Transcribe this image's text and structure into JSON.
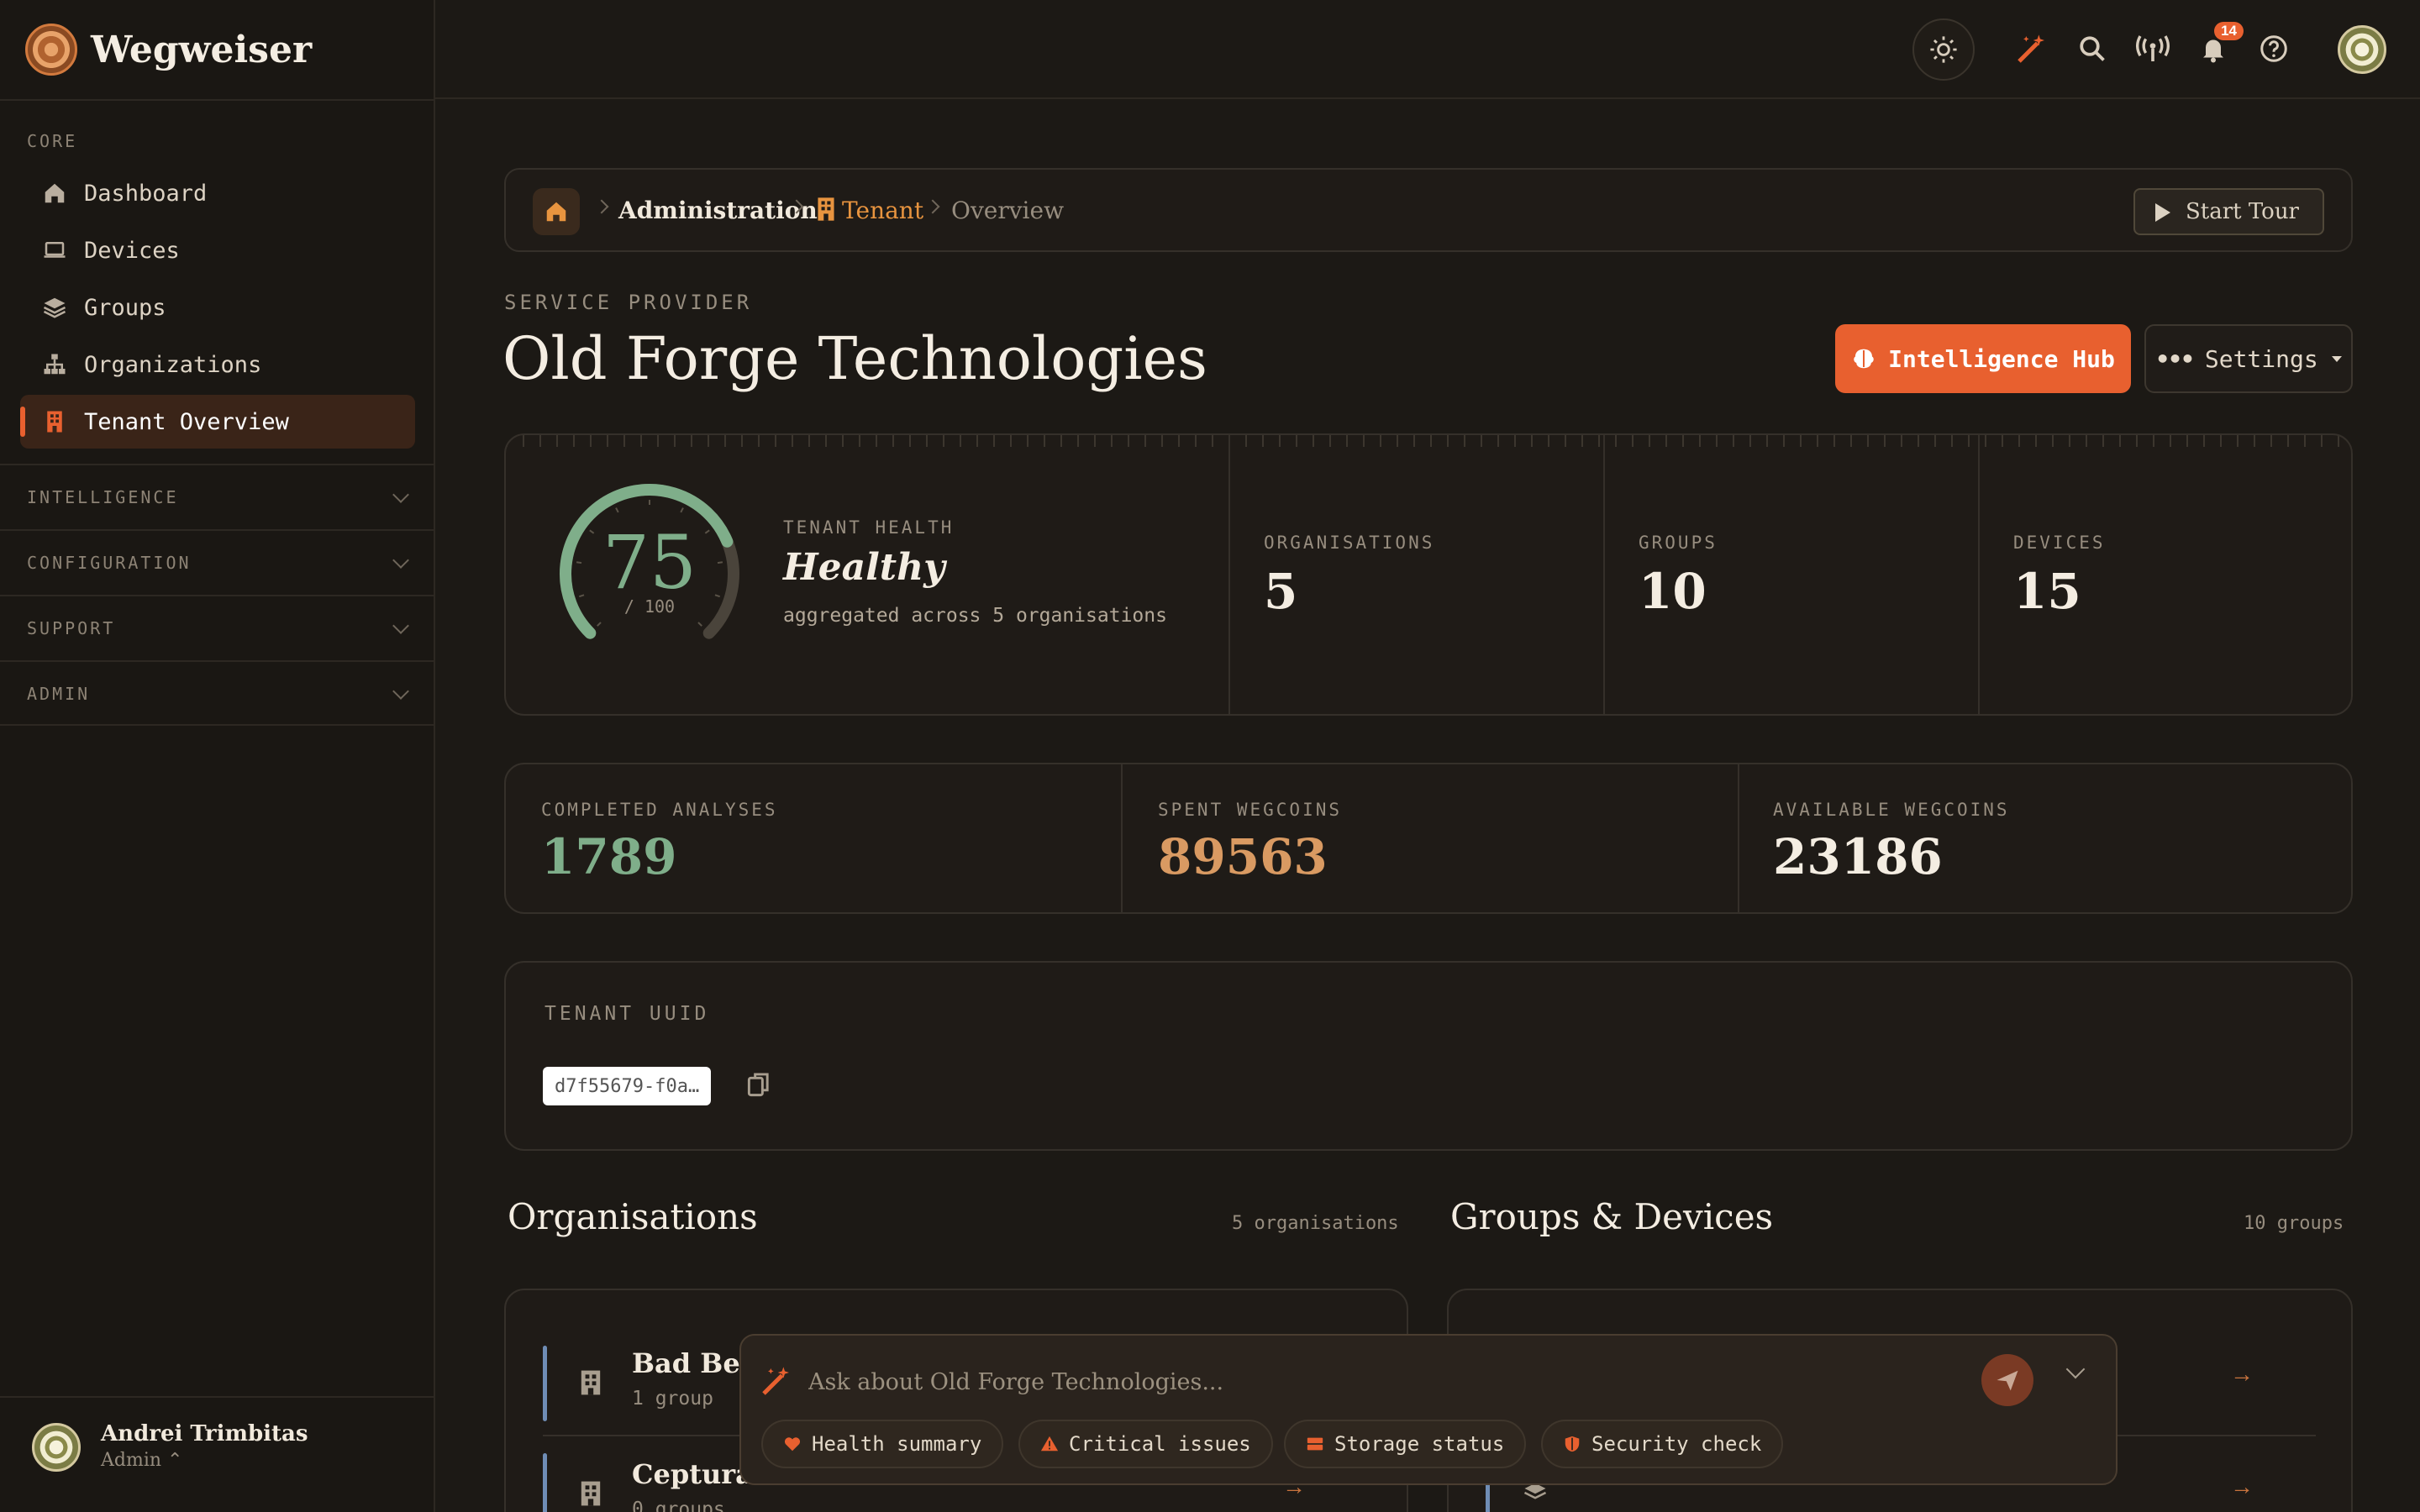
{
  "brand": {
    "name": "Wegweiser"
  },
  "sidebar": {
    "core_label": "CORE",
    "items": [
      {
        "label": "Dashboard",
        "icon": "home-icon"
      },
      {
        "label": "Devices",
        "icon": "laptop-icon"
      },
      {
        "label": "Groups",
        "icon": "layers-icon"
      },
      {
        "label": "Organizations",
        "icon": "org-chart-icon"
      },
      {
        "label": "Tenant Overview",
        "icon": "building-icon",
        "active": true
      }
    ],
    "sections": [
      "INTELLIGENCE",
      "CONFIGURATION",
      "SUPPORT",
      "ADMIN"
    ],
    "user": {
      "name": "Andrei Trimbitas",
      "role": "Admin ⌃"
    }
  },
  "topbar": {
    "notification_count": "14"
  },
  "breadcrumb": {
    "items": [
      "Administration",
      "Tenant",
      "Overview"
    ],
    "tour_label": "Start Tour"
  },
  "header": {
    "eyebrow": "SERVICE PROVIDER",
    "title": "Old Forge Technologies",
    "hub_label": "Intelligence Hub",
    "settings_label": "Settings"
  },
  "health": {
    "label": "TENANT HEALTH",
    "score": "75",
    "score_value": 75,
    "max": "/ 100",
    "status": "Healthy",
    "caption": "aggregated across 5 organisations"
  },
  "stats": [
    {
      "label": "ORGANISATIONS",
      "value": "5"
    },
    {
      "label": "GROUPS",
      "value": "10"
    },
    {
      "label": "DEVICES",
      "value": "15"
    }
  ],
  "wallet": [
    {
      "label": "COMPLETED ANALYSES",
      "value": "1789",
      "color": "#7fae8a"
    },
    {
      "label": "SPENT WEGCOINS",
      "value": "89563",
      "color": "#d99a62"
    },
    {
      "label": "AVAILABLE WEGCOINS",
      "value": "23186",
      "color": "#f4ede2"
    }
  ],
  "uuid": {
    "label": "TENANT UUID",
    "value": "d7f55679-f0a…"
  },
  "organisations": {
    "title": "Organisations",
    "count": "5 organisations",
    "rows": [
      {
        "name": "Bad Berl",
        "sub": "1 group"
      },
      {
        "name": "Ceptura",
        "sub": "0 groups"
      }
    ]
  },
  "groups_devices": {
    "title": "Groups & Devices",
    "count": "10 groups"
  },
  "ask": {
    "placeholder": "Ask about Old Forge Technologies...",
    "chips": [
      {
        "label": "Health summary",
        "icon": "heart-icon"
      },
      {
        "label": "Critical issues",
        "icon": "warning-icon"
      },
      {
        "label": "Storage status",
        "icon": "storage-icon"
      },
      {
        "label": "Security check",
        "icon": "shield-icon"
      }
    ]
  },
  "colors": {
    "accent": "#e8602f",
    "background": "#1c1915",
    "card": "#1f1b17"
  }
}
